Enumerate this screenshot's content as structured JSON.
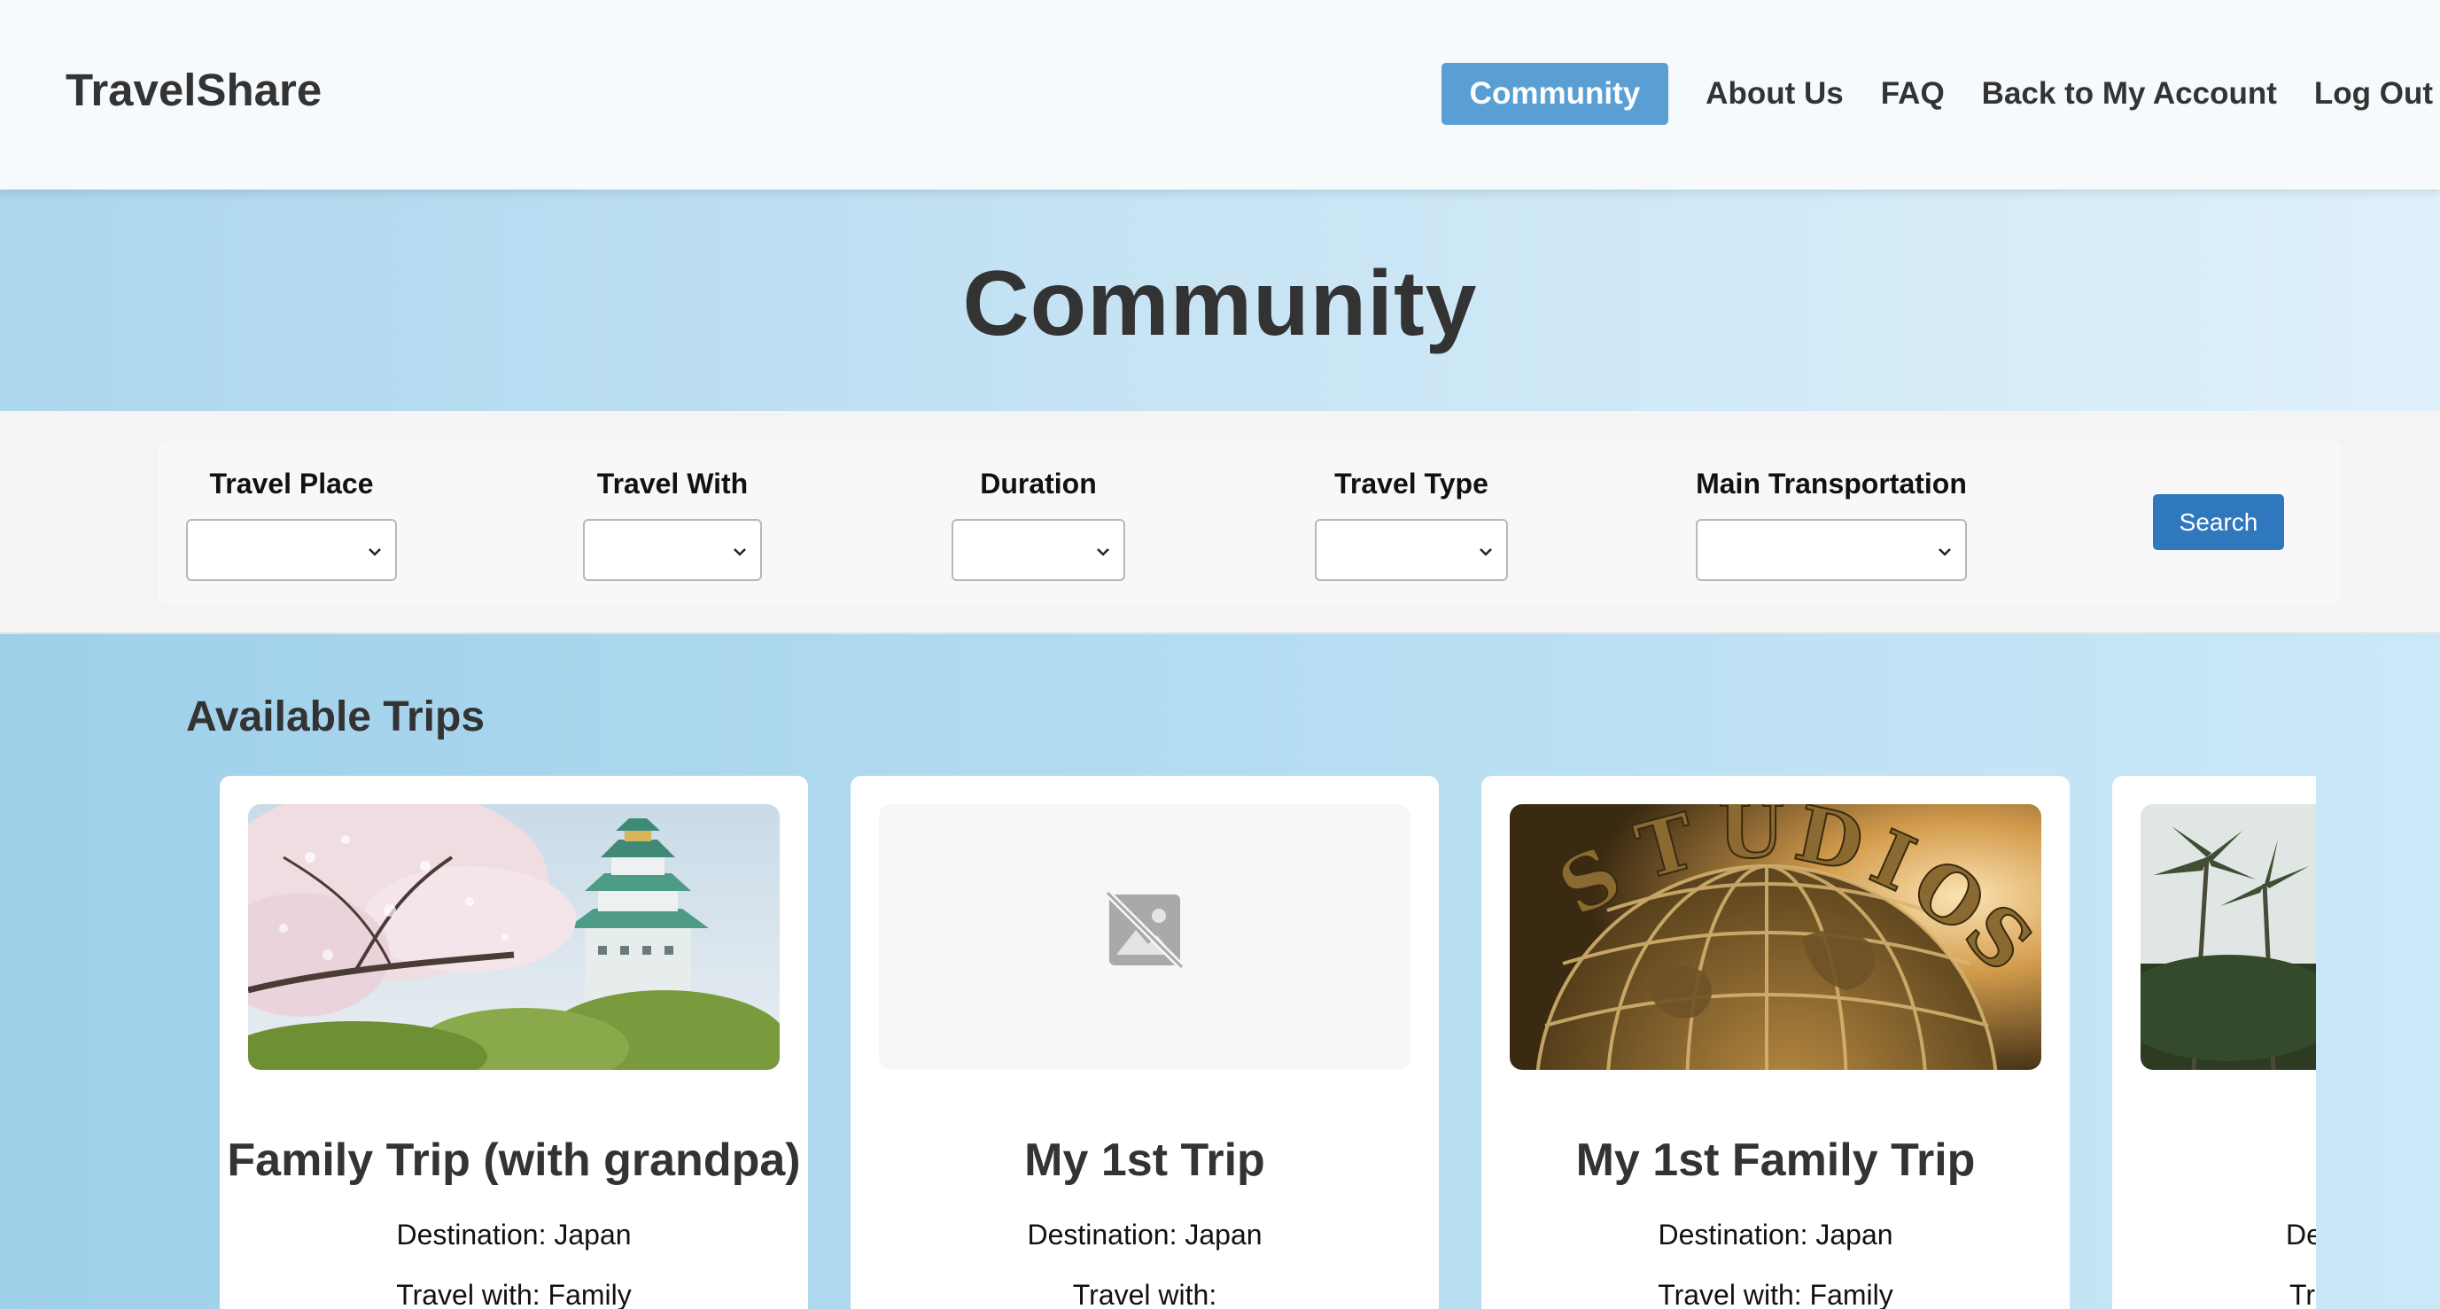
{
  "header": {
    "brand": "TravelShare",
    "nav": [
      {
        "label": "Community",
        "active": true
      },
      {
        "label": "About Us"
      },
      {
        "label": "FAQ"
      },
      {
        "label": "Back to My Account"
      },
      {
        "label": "Log Out"
      }
    ]
  },
  "hero": {
    "title": "Community"
  },
  "filters": {
    "travel_place": {
      "label": "Travel Place",
      "value": ""
    },
    "travel_with": {
      "label": "Travel With",
      "value": ""
    },
    "duration": {
      "label": "Duration",
      "value": ""
    },
    "travel_type": {
      "label": "Travel Type",
      "value": ""
    },
    "main_transportation": {
      "label": "Main Transportation",
      "value": ""
    },
    "search_label": "Search"
  },
  "trips": {
    "section_title": "Available Trips",
    "cards": [
      {
        "title": "Family Trip (with grandpa)",
        "destination": "Destination: Japan",
        "travel_with": "Travel with: Family",
        "image": "osaka-castle-cherry-blossom"
      },
      {
        "title": "My 1st Trip",
        "destination": "Destination: Japan",
        "travel_with": "Travel with:",
        "image": "image-placeholder-icon"
      },
      {
        "title": "My 1st Family Trip",
        "destination": "Destination: Japan",
        "travel_with": "Travel with: Family",
        "image": "universal-studios-globe"
      },
      {
        "title": "",
        "destination": "De",
        "travel_with": "Tr",
        "image": "palm-trees"
      }
    ]
  },
  "colors": {
    "nav_active_bg": "#5a9fd4",
    "search_button_bg": "#3078be",
    "hero_bg": "#c5e3f4"
  }
}
